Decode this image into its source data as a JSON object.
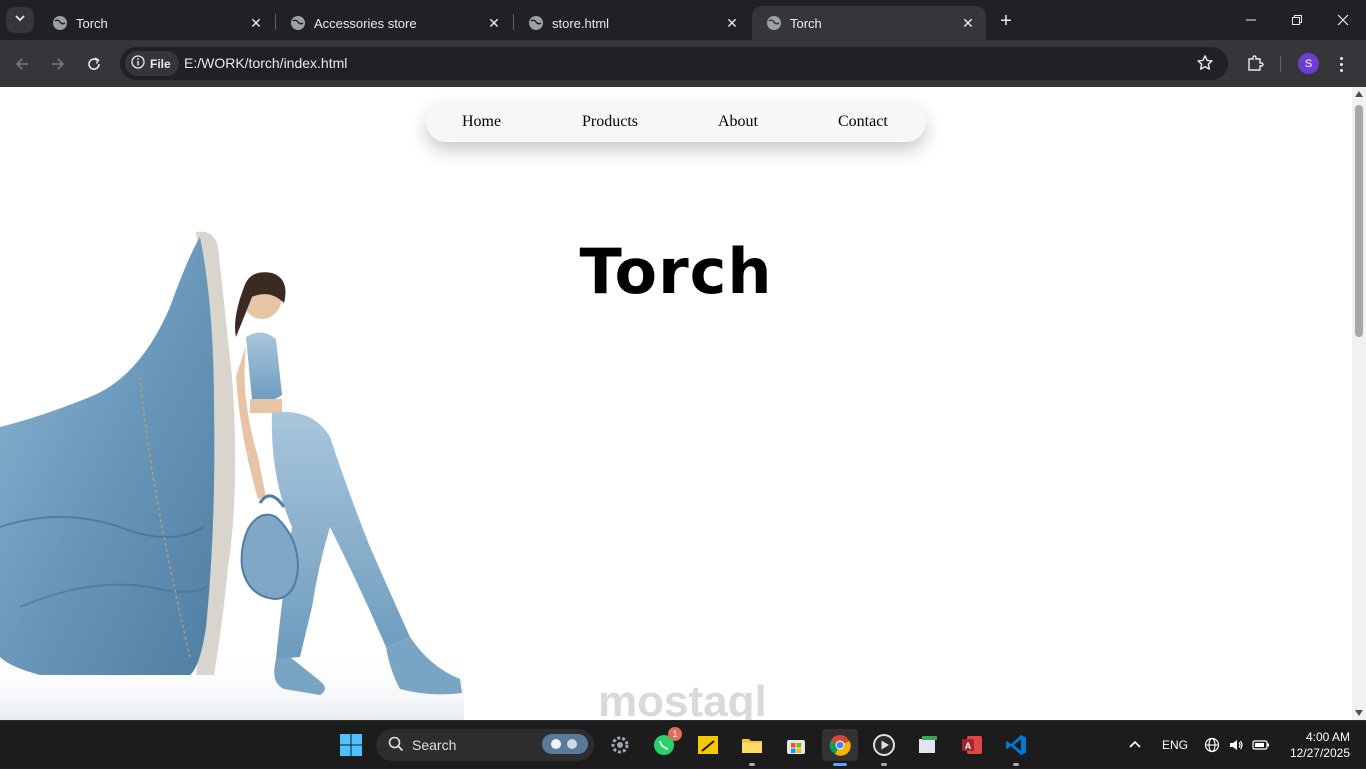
{
  "browser": {
    "tabs": [
      {
        "title": "Torch",
        "active": false
      },
      {
        "title": "Accessories store",
        "active": false
      },
      {
        "title": "store.html",
        "active": false
      },
      {
        "title": "Torch",
        "active": true
      }
    ],
    "omnibox": {
      "chip_label": "File",
      "url": "E:/WORK/torch/index.html"
    },
    "profile_initial": "S"
  },
  "page": {
    "nav": {
      "home": "Home",
      "products": "Products",
      "about": "About",
      "contact": "Contact"
    },
    "hero_title": "Torch",
    "watermark": "mostaql"
  },
  "taskbar": {
    "search_label": "Search",
    "whatsapp_badge": "1",
    "language": "ENG",
    "time": "4:00 AM",
    "date": "12/27/2025"
  },
  "colors": {
    "tabstrip": "#202124",
    "toolbar": "#35363a",
    "taskbar": "#1c1c1c",
    "page_bg": "#ffffff",
    "denim": "#6f9dbf"
  }
}
